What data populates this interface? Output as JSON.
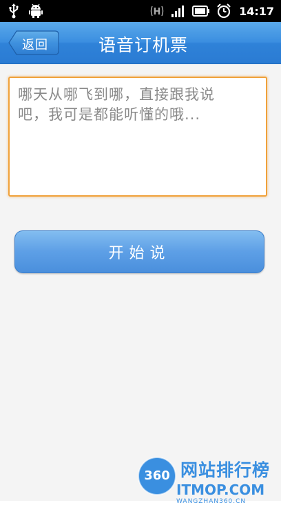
{
  "status_bar": {
    "network_label": "H",
    "time": "14:17",
    "icons": [
      "usb-icon",
      "android-debug-icon",
      "network-h-icon",
      "signal-icon",
      "battery-icon",
      "alarm-icon"
    ]
  },
  "header": {
    "back_label": "返回",
    "title": "语音订机票"
  },
  "voice_input": {
    "placeholder": "哪天从哪飞到哪，直接跟我说\n吧，我可是都能听懂的哦..."
  },
  "start_button": {
    "label": "开始说"
  },
  "watermark": {
    "badge": "360",
    "title": "网站排行榜",
    "site_label": "ITMOP.COM",
    "url": "WANGZHAN360.CN"
  },
  "colors": {
    "header_blue": "#3b8ee0",
    "input_border": "#f0a13a",
    "button_blue": "#5d9fe6"
  }
}
